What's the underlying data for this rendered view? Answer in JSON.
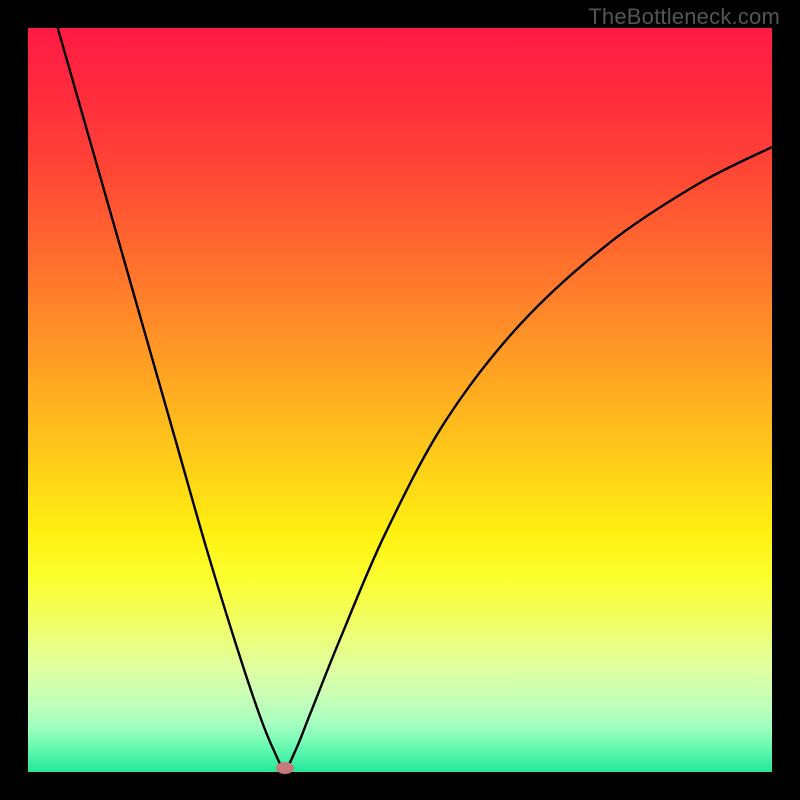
{
  "watermark": "TheBottleneck.com",
  "chart_data": {
    "type": "line",
    "title": "",
    "xlabel": "",
    "ylabel": "",
    "xlim": [
      0,
      100
    ],
    "ylim": [
      0,
      100
    ],
    "background_gradient": {
      "top": "#ff1a44",
      "middle": "#ffd318",
      "bottom": "#20e898"
    },
    "series": [
      {
        "name": "bottleneck-curve",
        "x": [
          4,
          8,
          12,
          16,
          20,
          24,
          28,
          31,
          33,
          34.5,
          36,
          38,
          42,
          48,
          56,
          66,
          78,
          90,
          100
        ],
        "y": [
          100,
          86,
          72,
          58,
          44,
          30,
          17,
          8,
          3,
          0.5,
          3,
          8,
          18,
          32,
          47,
          60,
          71,
          79,
          84
        ]
      }
    ],
    "marker": {
      "name": "optimal-point",
      "x": 34.5,
      "y": 0.5,
      "color": "#c77a7a"
    },
    "annotations": []
  }
}
